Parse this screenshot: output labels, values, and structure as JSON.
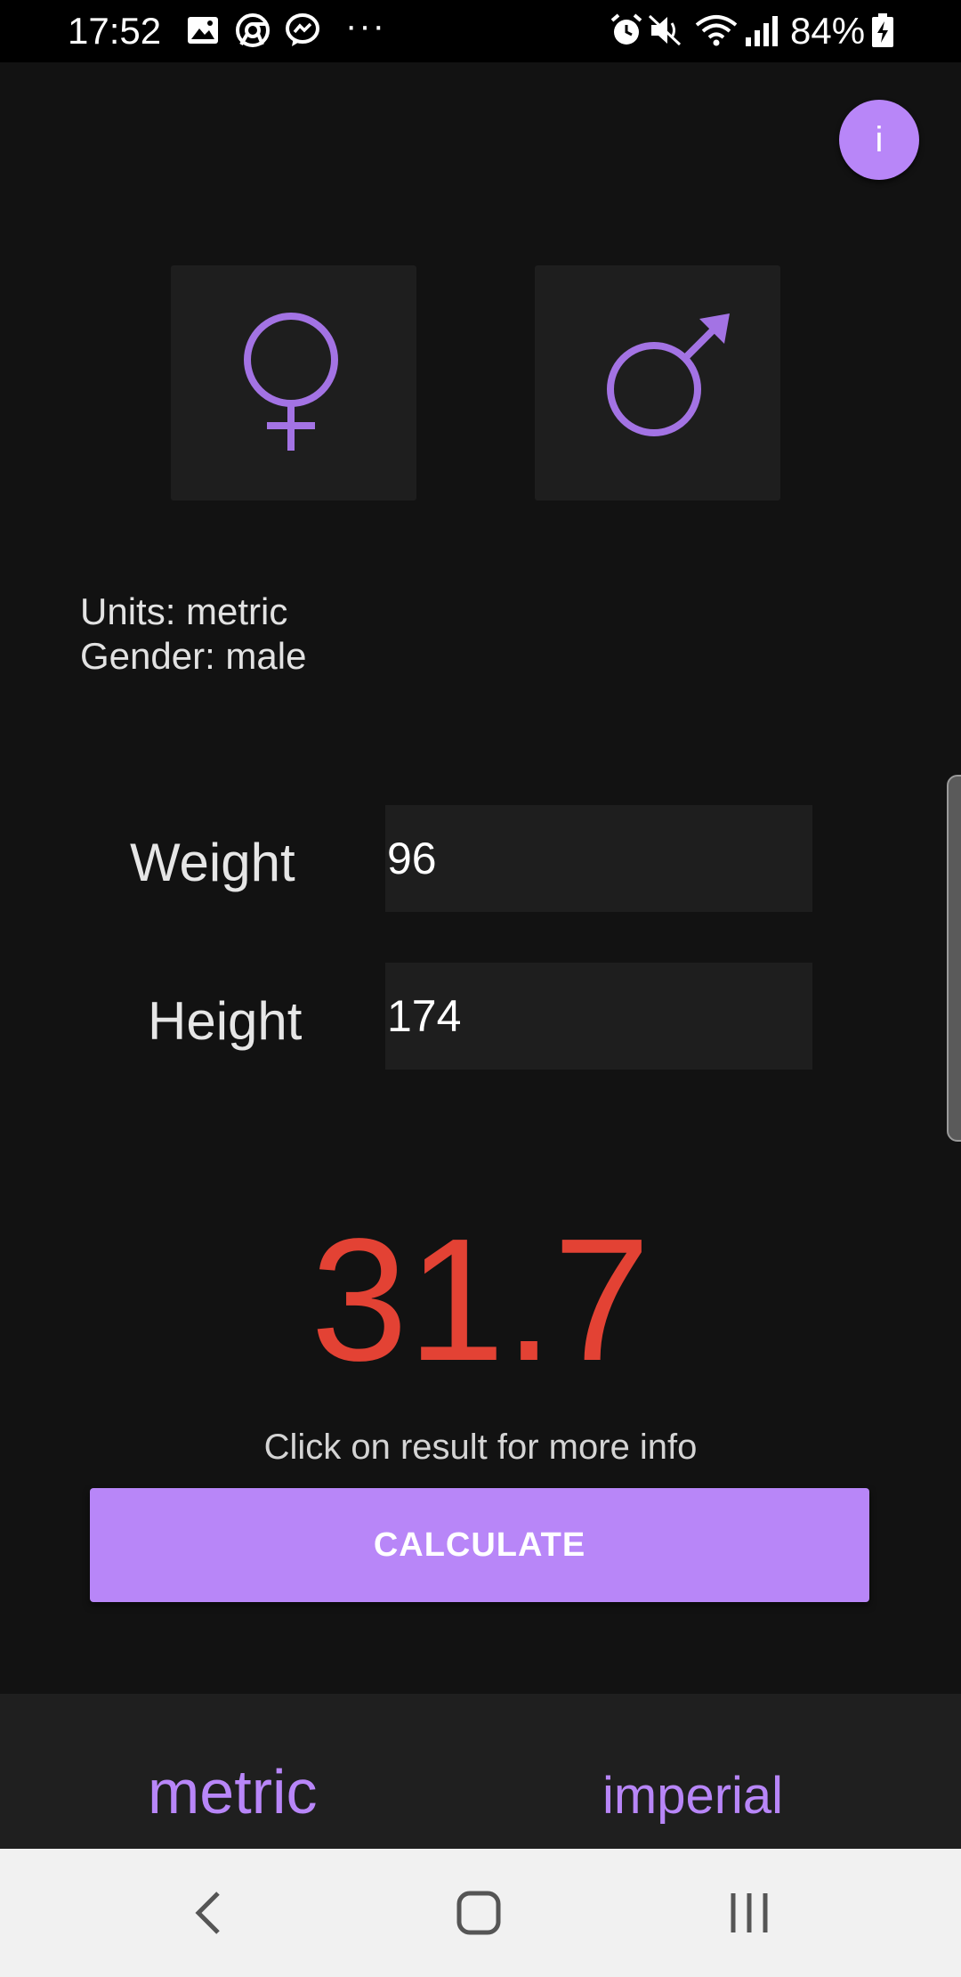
{
  "status_bar": {
    "time": "17:52",
    "dots": "···",
    "battery": "84%",
    "icons": [
      "image-icon",
      "chrome-icon",
      "messenger-icon",
      "alarm-icon",
      "mute-icon",
      "wifi-icon",
      "signal-icon",
      "battery-icon"
    ]
  },
  "header": {
    "info_label": "i"
  },
  "gender": {
    "female_icon": "female-symbol-icon",
    "male_icon": "male-symbol-icon",
    "accent_color": "#a373e4"
  },
  "info": {
    "units_line": "Units: metric",
    "gender_line": "Gender: male"
  },
  "form": {
    "weight_label": "Weight",
    "weight_value": "96",
    "height_label": "Height",
    "height_value": "174"
  },
  "result": {
    "value": "31.7",
    "color": "#e34234",
    "hint": "Click on result for more info"
  },
  "actions": {
    "calculate_label": "CALCULATE",
    "accent_color": "#b886f8"
  },
  "units": {
    "metric_label": "metric",
    "imperial_label": "imperial"
  },
  "nav": {
    "buttons": [
      "back-icon",
      "home-icon",
      "recents-icon"
    ]
  }
}
